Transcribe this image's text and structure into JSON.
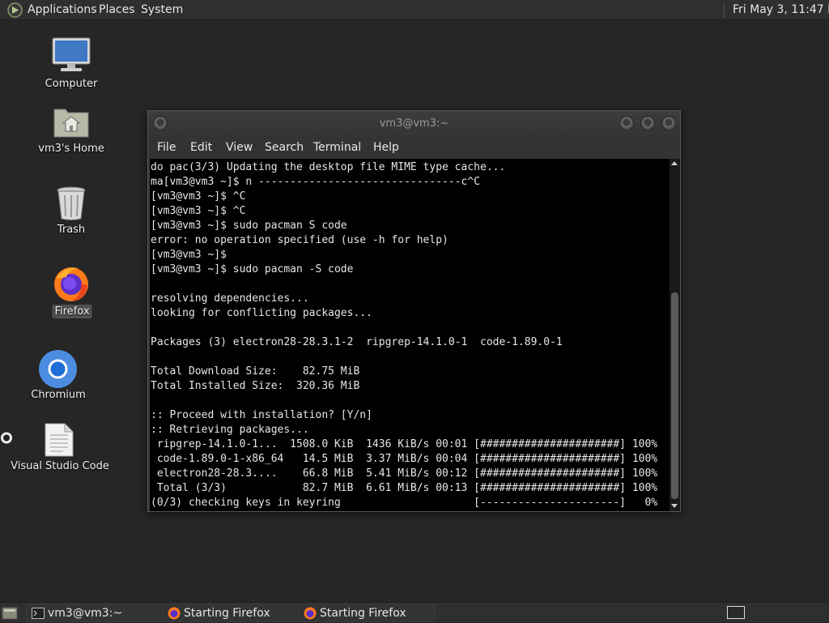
{
  "top_panel": {
    "menus": [
      "Applications",
      "Places",
      "System"
    ],
    "clock": "Fri May  3, 11:47 PM"
  },
  "desktop_icons": {
    "computer": "Computer",
    "home": "vm3's Home",
    "trash": "Trash",
    "firefox": "Firefox",
    "chromium": "Chromium",
    "vscode": "Visual Studio Code"
  },
  "terminal": {
    "title": "vm3@vm3:~",
    "menu": [
      "File",
      "Edit",
      "View",
      "Search",
      "Terminal",
      "Help"
    ],
    "lines": [
      "do pac(3/3) Updating the desktop file MIME type cache...",
      "ma[vm3@vm3 ~]$ n --------------------------------c^C",
      "[vm3@vm3 ~]$ ^C",
      "[vm3@vm3 ~]$ ^C",
      "[vm3@vm3 ~]$ sudo pacman S code",
      "error: no operation specified (use -h for help)",
      "[vm3@vm3 ~]$",
      "[vm3@vm3 ~]$ sudo pacman -S code",
      "",
      "resolving dependencies...",
      "looking for conflicting packages...",
      "",
      "Packages (3) electron28-28.3.1-2  ripgrep-14.1.0-1  code-1.89.0-1",
      "",
      "Total Download Size:    82.75 MiB",
      "Total Installed Size:  320.36 MiB",
      "",
      ":: Proceed with installation? [Y/n]",
      ":: Retrieving packages...",
      " ripgrep-14.1.0-1...  1508.0 KiB  1436 KiB/s 00:01 [######################] 100%",
      " code-1.89.0-1-x86_64   14.5 MiB  3.37 MiB/s 00:04 [######################] 100%",
      " electron28-28.3....    66.8 MiB  5.41 MiB/s 00:12 [######################] 100%",
      " Total (3/3)            82.7 MiB  6.61 MiB/s 00:13 [######################] 100%",
      "(0/3) checking keys in keyring                     [----------------------]   0%"
    ]
  },
  "taskbar": {
    "tasks": [
      "vm3@vm3:~",
      "Starting Firefox",
      "Starting Firefox"
    ]
  }
}
